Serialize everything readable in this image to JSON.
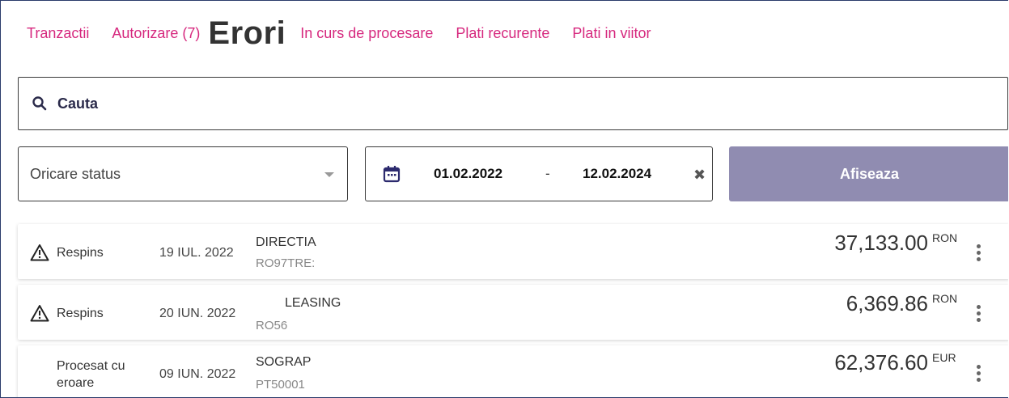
{
  "tabs": [
    {
      "label": "Tranzactii"
    },
    {
      "label": "Autorizare (7)"
    },
    {
      "label": "Erori"
    },
    {
      "label": "In curs de procesare"
    },
    {
      "label": "Plati recurente"
    },
    {
      "label": "Plati in viitor"
    }
  ],
  "search": {
    "label": "Cauta"
  },
  "filters": {
    "status": "Oricare status",
    "date_from": "01.02.2022",
    "date_sep": "-",
    "date_to": "12.02.2024",
    "clear": "✖",
    "show_button": "Afiseaza"
  },
  "transactions": [
    {
      "status": "Respins",
      "date": "19 IUL. 2022",
      "name": "DIRECTIA",
      "iban": "RO97TRE:",
      "amount": "37,133.00",
      "currency": "RON"
    },
    {
      "status": "Respins",
      "date": "20 IUN. 2022",
      "name": "LEASING",
      "iban": "RO56",
      "amount": "6,369.86",
      "currency": "RON"
    },
    {
      "status_line1": "Procesat cu",
      "status_line2": "eroare",
      "date": "09 IUN. 2022",
      "name": "SOGRAP",
      "iban": "PT50001",
      "amount": "62,376.60",
      "currency": "EUR"
    }
  ],
  "colors": {
    "accent": "#d6287e",
    "button": "#908cb1",
    "border": "#2a3b6a"
  }
}
